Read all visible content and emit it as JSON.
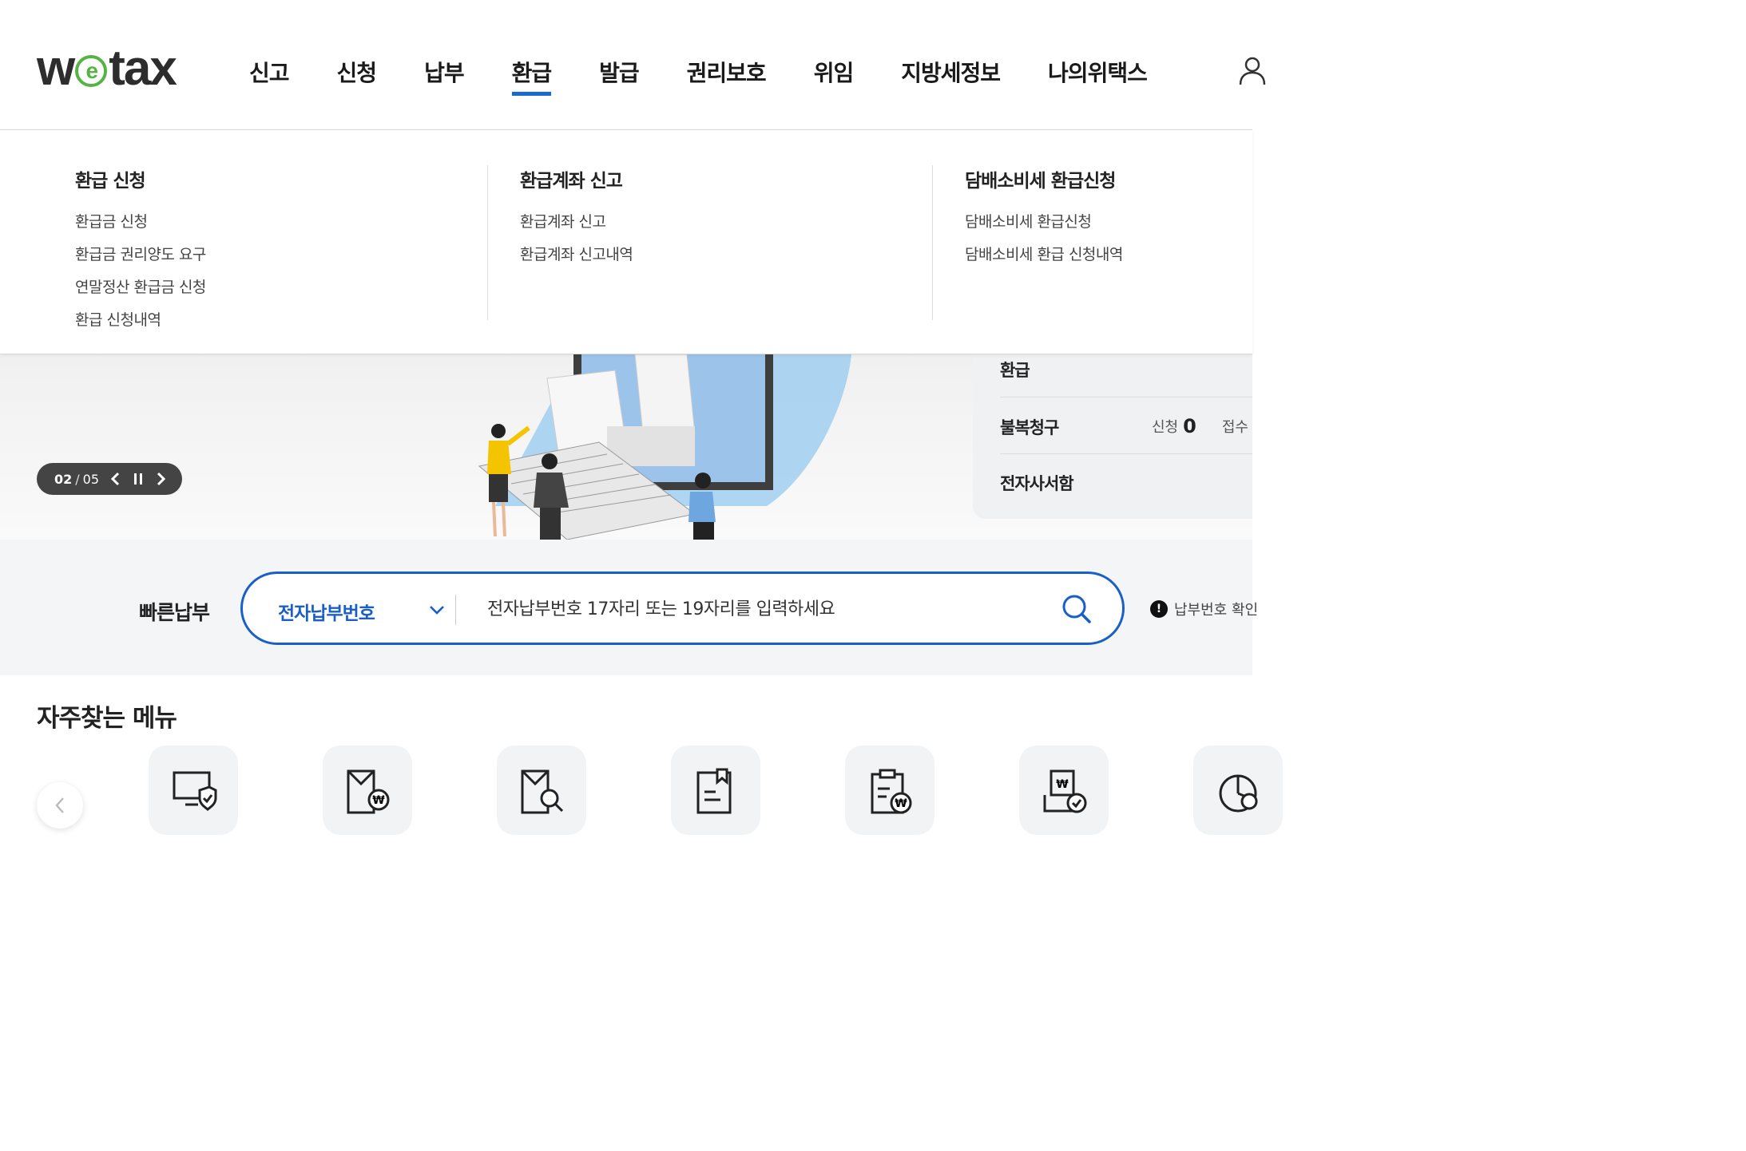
{
  "header": {
    "logo_text": "w",
    "logo_e": "e",
    "logo_rest": "tax",
    "nav": [
      "신고",
      "신청",
      "납부",
      "환급",
      "발급",
      "권리보호",
      "위임",
      "지방세정보",
      "나의위택스"
    ],
    "active_nav": "환급",
    "accent_color": "#1a6ad4"
  },
  "mega_menu": {
    "columns": [
      {
        "title": "환급 신청",
        "links": [
          "환급금 신청",
          "환급금 권리양도 요구",
          "연말정산 환급금 신청",
          "환급 신청내역"
        ]
      },
      {
        "title": "환급계좌 신고",
        "links": [
          "환급계좌 신고",
          "환급계좌 신고내역"
        ]
      },
      {
        "title": "담배소비세 환급신청",
        "links": [
          "담배소비세 환급신청",
          "담배소비세 환급 신청내역"
        ]
      }
    ]
  },
  "hero": {
    "slide_current": "02",
    "slide_sep": "/",
    "slide_total": "05"
  },
  "side_panel": {
    "row1": "환급",
    "row2": "불복청구",
    "row2_stat_label": "신청",
    "row2_stat_value": "0",
    "row2_stat2_label": "접수",
    "row3": "전자사서함"
  },
  "quick_pay": {
    "label": "빠른납부",
    "select_value": "전자납부번호",
    "placeholder": "전자납부번호 17자리 또는 19자리를 입력하세요",
    "notice": "납부번호 확인",
    "border_color": "#1a5fc8"
  },
  "frequent_menu": {
    "title": "자주찾는 메뉴",
    "icons": [
      "monitor-shield-icon",
      "envelope-won-icon",
      "envelope-search-icon",
      "document-bookmark-icon",
      "clipboard-won-icon",
      "tray-won-check-icon",
      "pie-chart-icon"
    ]
  }
}
